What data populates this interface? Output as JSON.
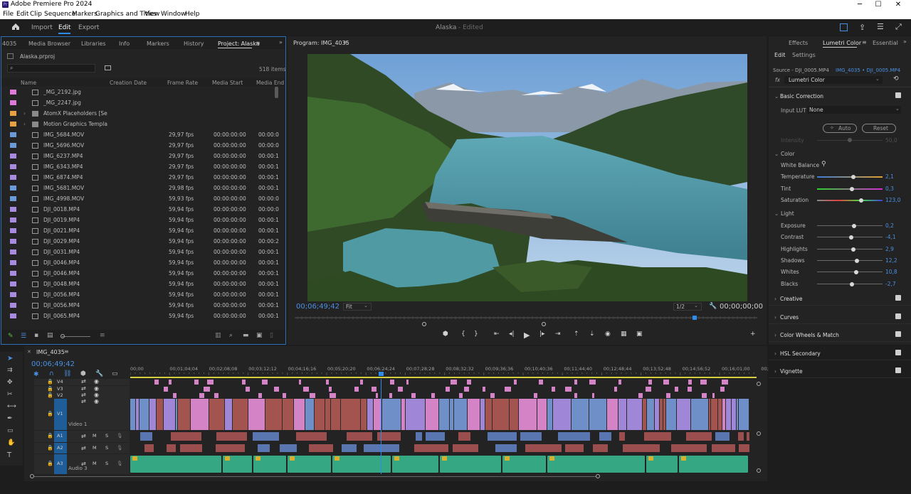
{
  "app": {
    "title": "Adobe Premiere Pro 2024",
    "logo_text": "Pr"
  },
  "menu": [
    "File",
    "Edit",
    "Clip",
    "Sequence",
    "Markers",
    "Graphics and Titles",
    "View",
    "Window",
    "Help"
  ],
  "workspace": {
    "tabs": [
      "Import",
      "Edit",
      "Export"
    ],
    "active": "Edit",
    "project_title": "Alaska",
    "status": "- Edited"
  },
  "project_panel": {
    "tabs": [
      "4035",
      "Media Browser",
      "Libraries",
      "Info",
      "Markers",
      "History",
      "Project: Alaska"
    ],
    "file": "Alaska.prproj",
    "item_count": "518 items",
    "search_placeholder": "",
    "columns": [
      "Name",
      "Creation Date",
      "Frame Rate",
      "Media Start",
      "Media End"
    ],
    "rows": [
      {
        "name": "_MG_2192.jpg",
        "color": "#e07ad8",
        "type": "file",
        "fps": "",
        "start": "",
        "end": ""
      },
      {
        "name": "_MG_2247.jpg",
        "color": "#e07ad8",
        "type": "file",
        "fps": "",
        "start": "",
        "end": ""
      },
      {
        "name": "AtomX Placeholders [Seaml",
        "color": "#e8a040",
        "type": "folder",
        "fps": "",
        "start": "",
        "end": ""
      },
      {
        "name": "Motion Graphics Template",
        "color": "#e8a040",
        "type": "folder",
        "fps": "",
        "start": "",
        "end": ""
      },
      {
        "name": "IMG_5684.MOV",
        "color": "#6a9ad8",
        "type": "file",
        "fps": "29,97 fps",
        "start": "00:00:00:00",
        "end": "00:00:0"
      },
      {
        "name": "IMG_5696.MOV",
        "color": "#6a9ad8",
        "type": "file",
        "fps": "29,97 fps",
        "start": "00:00:00:00",
        "end": "00:00:0"
      },
      {
        "name": "IMG_6237.MP4",
        "color": "#a88ae0",
        "type": "file",
        "fps": "29,97 fps",
        "start": "00:00:00:00",
        "end": "00:00:1"
      },
      {
        "name": "IMG_6343.MP4",
        "color": "#a88ae0",
        "type": "file",
        "fps": "29,97 fps",
        "start": "00:00:00:00",
        "end": "00:00:1"
      },
      {
        "name": "IMG_6874.MP4",
        "color": "#a88ae0",
        "type": "file",
        "fps": "29,97 fps",
        "start": "00:00:00:00",
        "end": "00:00:1"
      },
      {
        "name": "IMG_5681.MOV",
        "color": "#6a9ad8",
        "type": "file",
        "fps": "29,98 fps",
        "start": "00:00:00:00",
        "end": "00:00:1"
      },
      {
        "name": "IMG_4998.MOV",
        "color": "#6a9ad8",
        "type": "file",
        "fps": "59,93 fps",
        "start": "00:00:00:00",
        "end": "00:00:0"
      },
      {
        "name": "DJI_0018.MP4",
        "color": "#a88ae0",
        "type": "file",
        "fps": "59,94 fps",
        "start": "00:00:00:00",
        "end": "00:00:0"
      },
      {
        "name": "DJI_0019.MP4",
        "color": "#a88ae0",
        "type": "file",
        "fps": "59,94 fps",
        "start": "00:00:00:00",
        "end": "00:00:1"
      },
      {
        "name": "DJI_0021.MP4",
        "color": "#a88ae0",
        "type": "file",
        "fps": "59,94 fps",
        "start": "00:00:00:00",
        "end": "00:00:1"
      },
      {
        "name": "DJI_0029.MP4",
        "color": "#a88ae0",
        "type": "file",
        "fps": "59,94 fps",
        "start": "00:00:00:00",
        "end": "00:00:2"
      },
      {
        "name": "DJI_0031.MP4",
        "color": "#a88ae0",
        "type": "file",
        "fps": "59,94 fps",
        "start": "00:00:00:00",
        "end": "00:00:1"
      },
      {
        "name": "DJI_0046.MP4",
        "color": "#a88ae0",
        "type": "file",
        "fps": "59,94 fps",
        "start": "00:00:00:00",
        "end": "00:00:1"
      },
      {
        "name": "DJI_0046.MP4",
        "color": "#a88ae0",
        "type": "file",
        "fps": "59,94 fps",
        "start": "00:00:00:00",
        "end": "00:00:1"
      },
      {
        "name": "DJI_0048.MP4",
        "color": "#a88ae0",
        "type": "file",
        "fps": "59,94 fps",
        "start": "00:00:00:00",
        "end": "00:00:1"
      },
      {
        "name": "DJI_0056.MP4",
        "color": "#a88ae0",
        "type": "file",
        "fps": "59,94 fps",
        "start": "00:00:00:00",
        "end": "00:00:1"
      },
      {
        "name": "DJI_0056.MP4",
        "color": "#a88ae0",
        "type": "file",
        "fps": "59,94 fps",
        "start": "00:00:00:00",
        "end": "00:00:1"
      },
      {
        "name": "DJI_0065.MP4",
        "color": "#a88ae0",
        "type": "file",
        "fps": "59,94 fps",
        "start": "00:00:00:00",
        "end": "00:00:1"
      }
    ]
  },
  "program_monitor": {
    "title": "Program: IMG_4035",
    "timecode": "00;06;49;42",
    "zoom": "Fit",
    "resolution": "1/2",
    "duration": "00;00;00;00"
  },
  "lumetri": {
    "tabs": [
      "Effects",
      "Lumetri Color",
      "Essential"
    ],
    "subtabs": [
      "Edit",
      "Settings"
    ],
    "source": "Source - DJI_0005.MP4",
    "target": "IMG_4035 • DJI_0005.MP4",
    "fx": "fx",
    "effect": "Lumetri Color",
    "basic_correction": "Basic Correction",
    "input_lut_label": "Input LUT",
    "input_lut_value": "None",
    "auto": "Auto",
    "reset": "Reset",
    "intensity_label": "Intensity",
    "intensity_value": "50,0",
    "color_section": "Color",
    "white_balance": "White Balance",
    "color_sliders": [
      {
        "label": "Temperature",
        "value": "2,1",
        "pos": 0.55,
        "gradient": "linear-gradient(90deg,#3a7bd5,#e0a030)"
      },
      {
        "label": "Tint",
        "value": "0,3",
        "pos": 0.53,
        "gradient": "linear-gradient(90deg,#2bd52b,#d52bd5)"
      },
      {
        "label": "Saturation",
        "value": "123,0",
        "pos": 0.67,
        "gradient": "linear-gradient(90deg,#888,#e04040,#40e040,#4040e0)"
      }
    ],
    "light_section": "Light",
    "light_sliders": [
      {
        "label": "Exposure",
        "value": "0,2",
        "pos": 0.57
      },
      {
        "label": "Contrast",
        "value": "-4,1",
        "pos": 0.52
      },
      {
        "label": "Highlights",
        "value": "2,9",
        "pos": 0.55
      },
      {
        "label": "Shadows",
        "value": "12,2",
        "pos": 0.61
      },
      {
        "label": "Whites",
        "value": "10,8",
        "pos": 0.6
      },
      {
        "label": "Blacks",
        "value": "-2,7",
        "pos": 0.53
      }
    ],
    "sections": [
      "Creative",
      "Curves",
      "Color Wheels & Match",
      "HSL Secondary",
      "Vignette"
    ]
  },
  "timeline": {
    "sequence": "IMG_4035",
    "timecode": "00;06;49;42",
    "ruler": [
      "00;00",
      "00;01;04;04",
      "00;02;08;08",
      "00;03;12;12",
      "00;04;16;16",
      "00;05;20;20",
      "00;06;24;24",
      "00;07;28;28",
      "00;08;32;32",
      "00;09;36;36",
      "00;10;40;36",
      "00;11;44;40",
      "00;12;48;44",
      "00;13;52;48",
      "00;14;56;52",
      "00;16;01;00",
      "00;"
    ],
    "tracks": [
      {
        "id": "V4",
        "kind": "video"
      },
      {
        "id": "V3",
        "kind": "video"
      },
      {
        "id": "V2",
        "kind": "video"
      },
      {
        "id": "V1",
        "kind": "video",
        "name": "Video 1"
      },
      {
        "id": "A1",
        "kind": "audio"
      },
      {
        "id": "A2",
        "kind": "audio"
      },
      {
        "id": "A3",
        "kind": "audio",
        "name": "Audio 3"
      }
    ],
    "track_buttons": {
      "mute": "M",
      "solo": "S"
    },
    "colors": {
      "video_blue": "#6f8fc8",
      "video_purple": "#9f86d6",
      "video_red": "#a4544e",
      "video_pink": "#d583c7",
      "audio_green": "#35a883",
      "audio_blue": "#5a76b0"
    }
  }
}
